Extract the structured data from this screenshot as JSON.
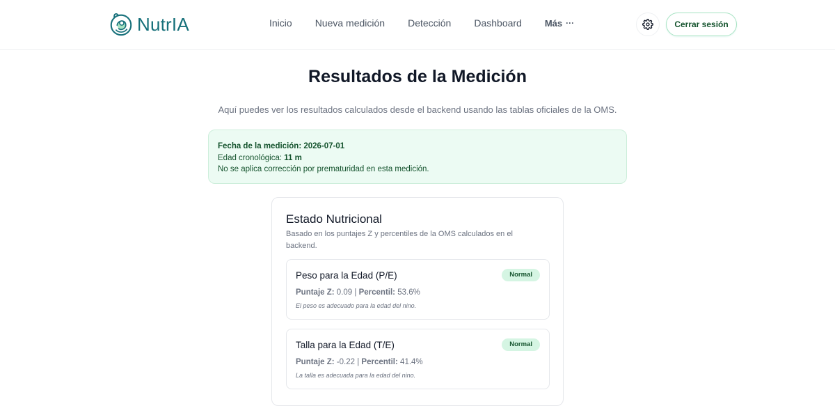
{
  "brand": {
    "name": "NutrIA",
    "color": "#16707a"
  },
  "nav": {
    "items": [
      "Inicio",
      "Nueva medición",
      "Detección",
      "Dashboard"
    ],
    "more_label": "Más",
    "more_icon": "ellipsis-icon"
  },
  "header": {
    "settings_icon": "gear-icon",
    "logout_label": "Cerrar sesión"
  },
  "page": {
    "title": "Resultados de la Medición",
    "subtitle": "Aquí puedes ver los resultados calculados desde el backend usando las tablas oficiales de la OMS."
  },
  "info": {
    "date_label": "Fecha de la medición:",
    "date_value": "2026-07-01",
    "age_label": "Edad cronológica:",
    "age_value": "11 m",
    "prematurity_note": "No se aplica corrección por prematuridad en esta medición."
  },
  "status_card": {
    "title": "Estado Nutricional",
    "description": "Basado en los puntajes Z y percentiles de la OMS calculados en el backend.",
    "metrics": [
      {
        "name": "Peso para la Edad (P/E)",
        "status": "Normal",
        "z_label": "Puntaje Z:",
        "z_value": "0.09",
        "separator": "|",
        "percentile_label": "Percentil:",
        "percentile_value": "53.6%",
        "note": "El peso es adecuado para la edad del nino."
      },
      {
        "name": "Talla para la Edad (T/E)",
        "status": "Normal",
        "z_label": "Puntaje Z:",
        "z_value": "-0.22",
        "separator": "|",
        "percentile_label": "Percentil:",
        "percentile_value": "41.4%",
        "note": "La talla es adecuada para la edad del nino."
      }
    ]
  },
  "colors": {
    "accent": "#16707a",
    "success_bg": "#ecfbf3",
    "badge_bg": "#d5f5e3",
    "badge_text": "#14532d"
  }
}
